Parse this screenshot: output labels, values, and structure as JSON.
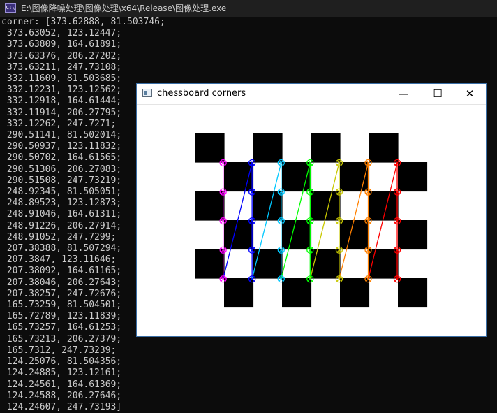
{
  "console": {
    "title": "E:\\图像降噪处理\\图像处理\\x64\\Release\\图像处理.exe",
    "icon": "console-app-icon",
    "icon_text": "C:\\",
    "lines": [
      "corner: [373.62888, 81.503746;",
      " 373.63052, 123.12447;",
      " 373.63809, 164.61891;",
      " 373.63376, 206.27202;",
      " 373.63211, 247.73108;",
      " 332.11609, 81.503685;",
      " 332.12231, 123.12562;",
      " 332.12918, 164.61444;",
      " 332.11914, 206.27795;",
      " 332.12262, 247.7271;",
      " 290.51141, 81.502014;",
      " 290.50937, 123.11832;",
      " 290.50702, 164.61565;",
      " 290.51306, 206.27083;",
      " 290.51508, 247.73219;",
      " 248.92345, 81.505051;",
      " 248.89523, 123.12873;",
      " 248.91046, 164.61311;",
      " 248.91226, 206.27914;",
      " 248.91052, 247.7299;",
      " 207.38388, 81.507294;",
      " 207.3847, 123.11646;",
      " 207.38092, 164.61165;",
      " 207.38046, 206.27643;",
      " 207.38257, 247.72676;",
      " 165.73259, 81.504501;",
      " 165.72789, 123.11839;",
      " 165.73257, 164.61253;",
      " 165.73213, 206.27379;",
      " 165.7312, 247.73239;",
      " 124.25076, 81.504356;",
      " 124.24885, 123.12161;",
      " 124.24561, 164.61369;",
      " 124.24588, 206.27646;",
      " 124.24607, 247.73193]"
    ]
  },
  "window": {
    "title": "chessboard corners",
    "icon": "image-window-icon",
    "minimize_icon": "minimize-icon",
    "maximize_icon": "maximize-icon",
    "close_icon": "close-icon",
    "minimize_glyph": "—",
    "maximize_glyph": "☐",
    "close_glyph": "✕",
    "background": "#ffffff"
  },
  "chessboard": {
    "rows": 6,
    "cols": 8,
    "colors": {
      "dark": "#000000",
      "light": "#ffffff"
    }
  },
  "corners": {
    "columns": [
      {
        "x": 124.25,
        "color": "#ff00ff"
      },
      {
        "x": 165.73,
        "color": "#0000ff"
      },
      {
        "x": 207.38,
        "color": "#00c8ff"
      },
      {
        "x": 248.91,
        "color": "#00ff00"
      },
      {
        "x": 290.51,
        "color": "#c8c800"
      },
      {
        "x": 332.12,
        "color": "#ff8000"
      },
      {
        "x": 373.63,
        "color": "#ff0000"
      }
    ],
    "ys": [
      81.5,
      123.12,
      164.61,
      206.27,
      247.73
    ],
    "connector_color": "#00ff00"
  }
}
